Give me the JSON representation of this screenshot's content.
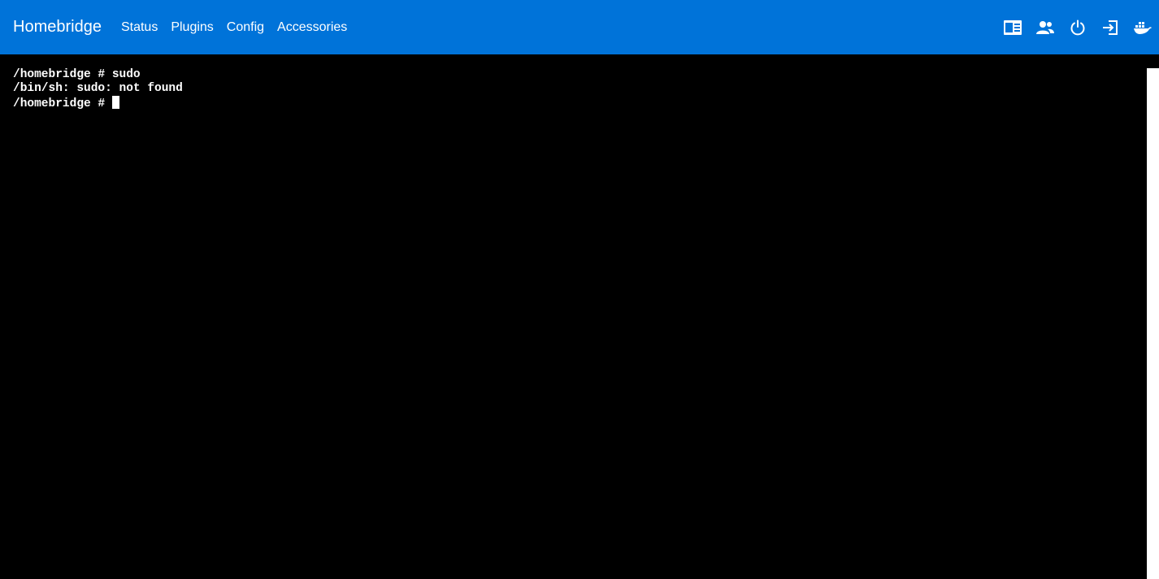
{
  "navbar": {
    "brand": "Homebridge",
    "links": [
      {
        "label": "Status"
      },
      {
        "label": "Plugins"
      },
      {
        "label": "Config"
      },
      {
        "label": "Accessories"
      }
    ],
    "icons": [
      "logs-icon",
      "users-icon",
      "power-icon",
      "logout-icon",
      "docker-icon"
    ],
    "background_color": "#0073d9"
  },
  "terminal": {
    "lines": [
      "/homebridge # sudo",
      "/bin/sh: sudo: not found",
      "/homebridge # "
    ],
    "background_color": "#000000",
    "text_color": "#ffffff"
  }
}
